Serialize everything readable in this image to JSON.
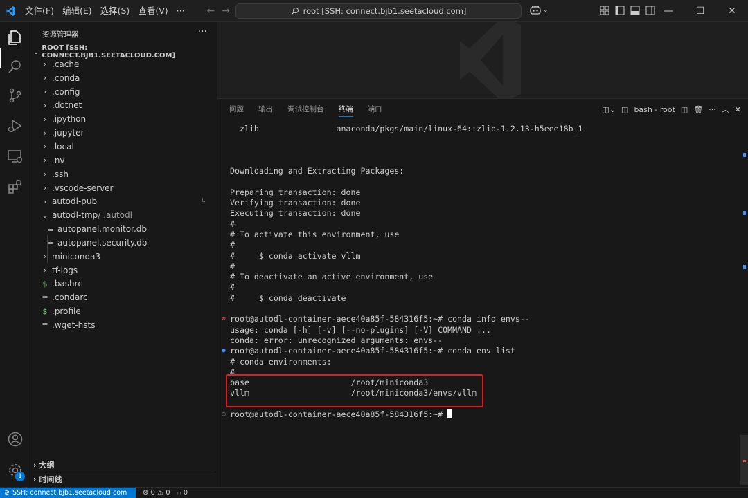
{
  "menu": {
    "items": [
      "文件(F)",
      "编辑(E)",
      "选择(S)",
      "查看(V)",
      "···"
    ]
  },
  "command_center": {
    "text": "root [SSH: connect.bjb1.seetacloud.com]"
  },
  "sidebar": {
    "title": "资源管理器",
    "more": "···",
    "root_label": "ROOT [SSH: CONNECT.BJB1.SEETACLOUD.COM]",
    "items": [
      {
        "name": ".cache",
        "kind": "folder"
      },
      {
        "name": ".conda",
        "kind": "folder"
      },
      {
        "name": ".config",
        "kind": "folder"
      },
      {
        "name": ".dotnet",
        "kind": "folder"
      },
      {
        "name": ".ipython",
        "kind": "folder"
      },
      {
        "name": ".jupyter",
        "kind": "folder"
      },
      {
        "name": ".local",
        "kind": "folder"
      },
      {
        "name": ".nv",
        "kind": "folder"
      },
      {
        "name": ".ssh",
        "kind": "folder"
      },
      {
        "name": ".vscode-server",
        "kind": "folder"
      },
      {
        "name": "autodl-pub",
        "kind": "folder"
      },
      {
        "name": "autodl-tmp",
        "suffix": "/ .autodl",
        "kind": "folder-open"
      },
      {
        "name": "autopanel.monitor.db",
        "kind": "file-child"
      },
      {
        "name": "autopanel.security.db",
        "kind": "file-child"
      },
      {
        "name": "miniconda3",
        "kind": "folder"
      },
      {
        "name": "tf-logs",
        "kind": "folder"
      },
      {
        "name": ".bashrc",
        "kind": "shell"
      },
      {
        "name": ".condarc",
        "kind": "file"
      },
      {
        "name": ".profile",
        "kind": "shell"
      },
      {
        "name": ".wget-hsts",
        "kind": "file"
      }
    ],
    "outline_label": "大纲",
    "timeline_label": "时间线"
  },
  "panel": {
    "tabs": [
      "问题",
      "输出",
      "调试控制台",
      "终端",
      "端口"
    ],
    "active_tab": "终端",
    "terminal_name": "bash - root"
  },
  "terminal": {
    "lines": [
      {
        "text": "  zlib                anaconda/pkgs/main/linux-64::zlib-1.2.13-h5eee18b_1",
        "deco": ""
      },
      {
        "text": "",
        "deco": ""
      },
      {
        "text": "",
        "deco": ""
      },
      {
        "text": "",
        "deco": ""
      },
      {
        "text": "Downloading and Extracting Packages:",
        "deco": ""
      },
      {
        "text": "",
        "deco": ""
      },
      {
        "text": "Preparing transaction: done",
        "deco": ""
      },
      {
        "text": "Verifying transaction: done",
        "deco": ""
      },
      {
        "text": "Executing transaction: done",
        "deco": ""
      },
      {
        "text": "#",
        "deco": ""
      },
      {
        "text": "# To activate this environment, use",
        "deco": ""
      },
      {
        "text": "#",
        "deco": ""
      },
      {
        "text": "#     $ conda activate vllm",
        "deco": ""
      },
      {
        "text": "#",
        "deco": ""
      },
      {
        "text": "# To deactivate an active environment, use",
        "deco": ""
      },
      {
        "text": "#",
        "deco": ""
      },
      {
        "text": "#     $ conda deactivate",
        "deco": ""
      },
      {
        "text": "",
        "deco": ""
      },
      {
        "text": "root@autodl-container-aece40a85f-584316f5:~# conda info envs--",
        "deco": "err"
      },
      {
        "text": "usage: conda [-h] [-v] [--no-plugins] [-V] COMMAND ...",
        "deco": ""
      },
      {
        "text": "conda: error: unrecognized arguments: envs--",
        "deco": ""
      },
      {
        "text": "root@autodl-container-aece40a85f-584316f5:~# conda env list",
        "deco": "ok"
      },
      {
        "text": "# conda environments:",
        "deco": ""
      },
      {
        "text": "#",
        "deco": ""
      },
      {
        "text": "base                     /root/miniconda3",
        "deco": ""
      },
      {
        "text": "vllm                     /root/miniconda3/envs/vllm",
        "deco": ""
      },
      {
        "text": "",
        "deco": ""
      },
      {
        "text": "root@autodl-container-aece40a85f-584316f5:~# ",
        "deco": "none",
        "cursor": true
      }
    ]
  },
  "statusbar": {
    "remote": "SSH: connect.bjb1.seetacloud.com",
    "problems": "⊗ 0 ⚠ 0",
    "ports": "⑃ 0"
  },
  "colors": {
    "accent": "#0078d4",
    "highlight": "#e21b1b"
  }
}
